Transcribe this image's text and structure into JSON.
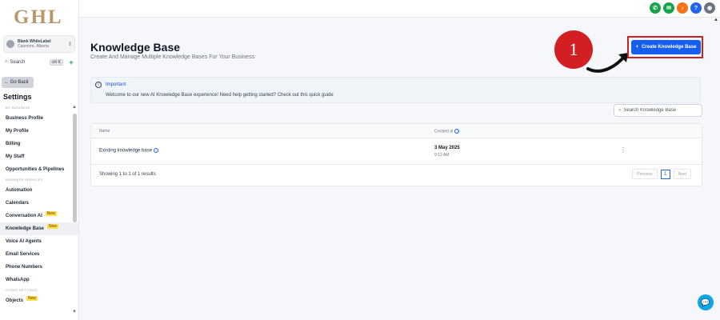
{
  "sidebar": {
    "logo": "GHL",
    "location": {
      "name": "Blank WhiteLabel",
      "sub": "Canmore, Alberta"
    },
    "search": {
      "label": "Search",
      "shortcut": "ctrl K",
      "quick_add": "+"
    },
    "go_back": "← Go Back",
    "title": "Settings",
    "sections": {
      "my_business": "MY BUSINESS",
      "business_services": "BUSINESS SERVICES",
      "other_settings": "OTHER SETTINGS"
    },
    "items": [
      {
        "label": "Business Profile"
      },
      {
        "label": "My Profile"
      },
      {
        "label": "Billing"
      },
      {
        "label": "My Staff"
      },
      {
        "label": "Opportunities & Pipelines"
      },
      {
        "label": "Automation"
      },
      {
        "label": "Calendars"
      },
      {
        "label": "Conversation AI",
        "badge": "New"
      },
      {
        "label": "Knowledge Base",
        "badge": "New",
        "active": true
      },
      {
        "label": "Voice AI Agents"
      },
      {
        "label": "Email Services"
      },
      {
        "label": "Phone Numbers"
      },
      {
        "label": "WhatsApp"
      },
      {
        "label": "Objects",
        "badge": "New"
      }
    ]
  },
  "topbar": {
    "icons": [
      {
        "name": "phone-icon",
        "glyph": "✆",
        "color": "#16a34a"
      },
      {
        "name": "megaphone-icon",
        "glyph": "✉",
        "color": "#16a34a"
      },
      {
        "name": "bell-icon",
        "glyph": "♪",
        "color": "#f97316"
      },
      {
        "name": "help-icon",
        "glyph": "?",
        "color": "#2563eb"
      },
      {
        "name": "avatar-icon",
        "glyph": "◉",
        "color": "#6b7280"
      }
    ]
  },
  "page": {
    "title": "Knowledge Base",
    "subtitle": "Create And Manage Multiple Knowledge Bases For Your Business",
    "create_button": "Create Knowledge Base",
    "create_button_icon": "+",
    "annotation_step": "1"
  },
  "important": {
    "title": "Important",
    "text": "Welcome to our new AI Knowledge Base experience! Need help getting started? Check out this quick guide"
  },
  "search": {
    "placeholder": "Search Knowledge Base"
  },
  "table": {
    "columns": [
      "Name",
      "Created at"
    ],
    "rows": [
      {
        "name": "Existing knowledge base",
        "date": "3 May 2025",
        "time": "9:12 AM",
        "menu": "⋮"
      }
    ],
    "results_text": "Showing 1 to 1 of 1 results",
    "pagination": {
      "previous": "Previous",
      "page": "1",
      "next": "Next"
    }
  },
  "colors": {
    "primary": "#155eef",
    "annotation_red": "#d11f24",
    "logo_gold": "#b8986a"
  }
}
